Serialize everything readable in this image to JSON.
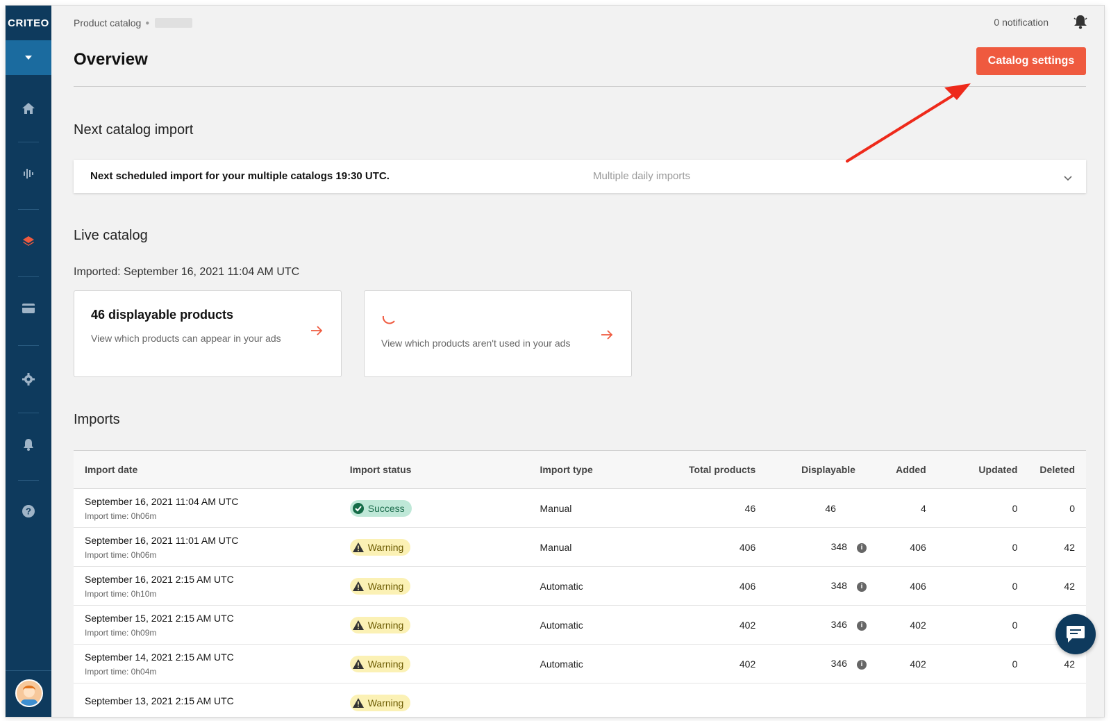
{
  "sidebar": {
    "logo": "CRITEO",
    "nav": [
      "home-icon",
      "analytics-icon",
      "catalog-icon",
      "billing-icon",
      "settings-icon",
      "alerts-icon",
      "help-icon"
    ]
  },
  "header": {
    "breadcrumb": "Product catalog",
    "notifications": "0 notification",
    "title": "Overview",
    "catalog_settings": "Catalog settings"
  },
  "next_import": {
    "section_title": "Next catalog import",
    "text": "Next scheduled import for your multiple catalogs 19:30 UTC.",
    "frequency": "Multiple daily imports"
  },
  "live_catalog": {
    "section_title": "Live catalog",
    "imported": "Imported: September 16, 2021 11:04 AM UTC",
    "card1_title": "46 displayable products",
    "card1_desc": "View which products can appear in your ads",
    "card2_desc": "View which products aren't used in your ads"
  },
  "imports": {
    "section_title": "Imports",
    "columns": [
      "Import date",
      "Import status",
      "Import type",
      "Total products",
      "Displayable",
      "Added",
      "Updated",
      "Deleted"
    ],
    "rows": [
      {
        "date": "September 16, 2021 11:04 AM UTC",
        "time": "Import time: 0h06m",
        "status": "Success",
        "type": "Manual",
        "total": "46",
        "displayable": "46",
        "added": "4",
        "updated": "0",
        "deleted": "0"
      },
      {
        "date": "September 16, 2021 11:01 AM UTC",
        "time": "Import time: 0h06m",
        "status": "Warning",
        "type": "Manual",
        "total": "406",
        "displayable": "348",
        "added": "406",
        "updated": "0",
        "deleted": "42"
      },
      {
        "date": "September 16, 2021 2:15 AM UTC",
        "time": "Import time: 0h10m",
        "status": "Warning",
        "type": "Automatic",
        "total": "406",
        "displayable": "348",
        "added": "406",
        "updated": "0",
        "deleted": "42"
      },
      {
        "date": "September 15, 2021 2:15 AM UTC",
        "time": "Import time: 0h09m",
        "status": "Warning",
        "type": "Automatic",
        "total": "402",
        "displayable": "346",
        "added": "402",
        "updated": "0",
        "deleted": ""
      },
      {
        "date": "September 14, 2021 2:15 AM UTC",
        "time": "Import time: 0h04m",
        "status": "Warning",
        "type": "Automatic",
        "total": "402",
        "displayable": "346",
        "added": "402",
        "updated": "0",
        "deleted": "42"
      },
      {
        "date": "September 13, 2021 2:15 AM UTC",
        "time": "",
        "status": "Warning",
        "type": "",
        "total": "",
        "displayable": "",
        "added": "",
        "updated": "",
        "deleted": ""
      }
    ]
  },
  "colors": {
    "sidebar": "#0e3a5d",
    "accent": "#ef5a3f",
    "success": "#bfe8d8",
    "warning": "#fbf1b5"
  }
}
